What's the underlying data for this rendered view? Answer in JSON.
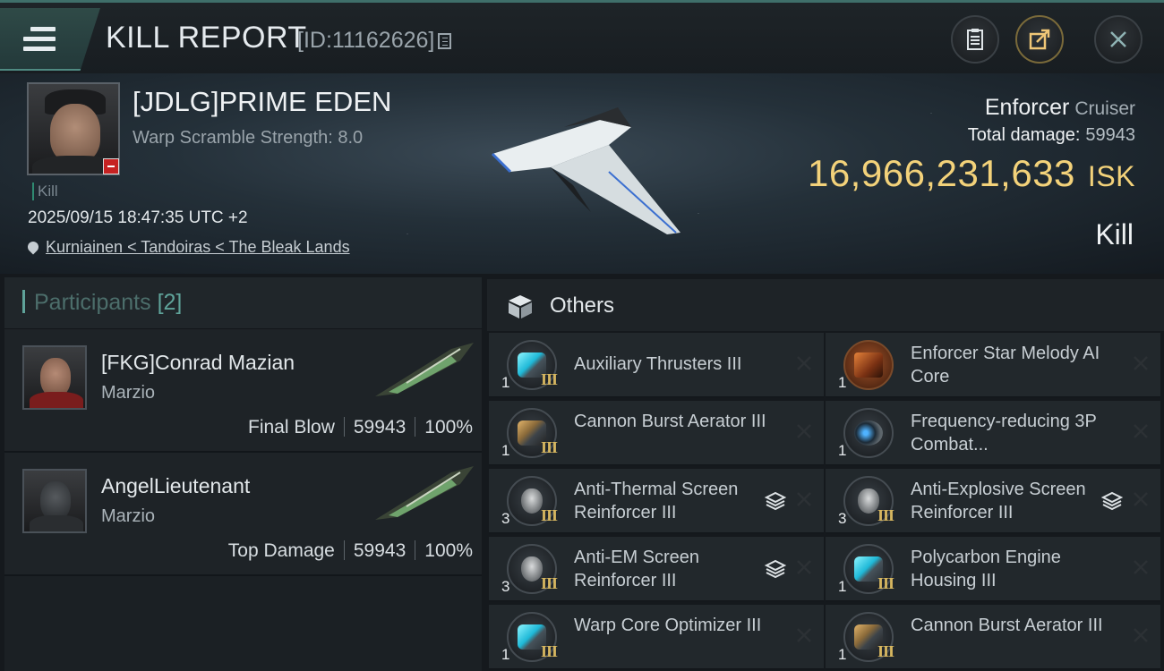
{
  "header": {
    "title": "KILL REPORT",
    "report_id": "[ID:11162626]"
  },
  "victim": {
    "name": "[JDLG]PRIME EDEN",
    "warp_scramble": "Warp Scramble Strength: 8.0",
    "tag": "Kill",
    "datetime": "2025/09/15 18:47:35 UTC +2",
    "location": "Kurniainen < Tandoiras < The Bleak Lands",
    "ship": "Enforcer",
    "ship_class": "Cruiser",
    "total_damage_label": "Total damage:",
    "total_damage": "59943",
    "isk_value": "16,966,231,633",
    "isk_unit": "ISK",
    "result": "Kill"
  },
  "participants": {
    "label": "Participants",
    "count": "[2]",
    "list": [
      {
        "name": "[FKG]Conrad Mazian",
        "corp": "Marzio",
        "role": "Final Blow",
        "damage": "59943",
        "percent": "100%"
      },
      {
        "name": "AngelLieutenant",
        "corp": "Marzio",
        "role": "Top Damage",
        "damage": "59943",
        "percent": "100%"
      }
    ]
  },
  "others": {
    "title": "Others",
    "items": [
      {
        "name": "Auxiliary Thrusters III",
        "qty": "1",
        "tier": "III",
        "icon": "thruster-icon",
        "stack": false
      },
      {
        "name": "Enforcer Star Melody AI Core",
        "qty": "1",
        "tier": "",
        "icon": "ai-core-icon",
        "stack": false
      },
      {
        "name": "Cannon Burst Aerator III",
        "qty": "1",
        "tier": "III",
        "icon": "cannon-icon",
        "stack": false
      },
      {
        "name": "Frequency-reducing 3P Combat...",
        "qty": "1",
        "tier": "",
        "icon": "frequency-module-icon",
        "stack": false
      },
      {
        "name": "Anti-Thermal Screen Reinforcer III",
        "qty": "3",
        "tier": "III",
        "icon": "shield-icon",
        "stack": true
      },
      {
        "name": "Anti-Explosive Screen Reinforcer III",
        "qty": "3",
        "tier": "III",
        "icon": "shield-icon",
        "stack": true
      },
      {
        "name": "Anti-EM Screen Reinforcer III",
        "qty": "3",
        "tier": "III",
        "icon": "shield-icon",
        "stack": true
      },
      {
        "name": "Polycarbon Engine Housing III",
        "qty": "1",
        "tier": "III",
        "icon": "thruster-icon",
        "stack": false
      },
      {
        "name": "Warp Core Optimizer III",
        "qty": "1",
        "tier": "III",
        "icon": "thruster-icon",
        "stack": false
      },
      {
        "name": "Cannon Burst Aerator III",
        "qty": "1",
        "tier": "III",
        "icon": "cannon-icon",
        "stack": false
      }
    ]
  }
}
